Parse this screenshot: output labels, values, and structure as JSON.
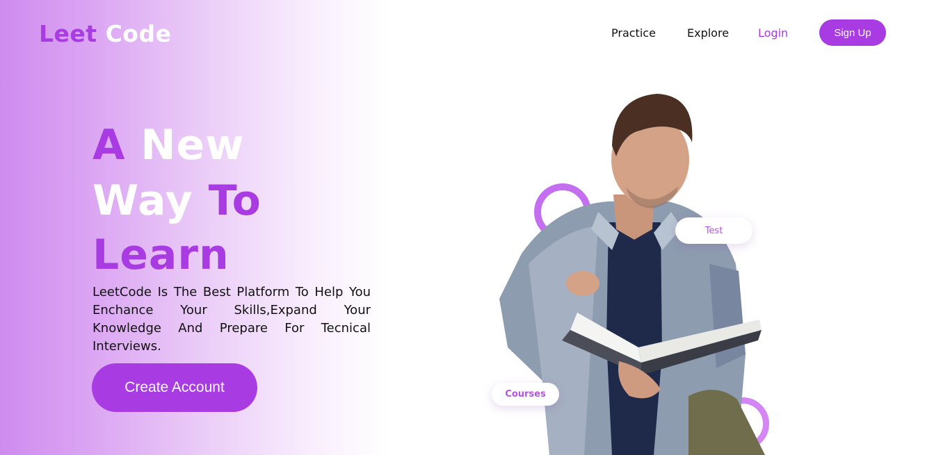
{
  "header": {
    "logo": {
      "part1": "Leet",
      "part2": "Code"
    },
    "nav": [
      {
        "label": "Practice"
      },
      {
        "label": "Explore"
      },
      {
        "label": "Login"
      }
    ],
    "signup_label": "Sign Up"
  },
  "hero": {
    "title_line1": {
      "a": "A",
      "b": "New"
    },
    "title_line2": {
      "a": "Way",
      "b": "To"
    },
    "title_line3": "Learn",
    "description": "LeetCode Is The Best Platform To Help You Enchance Your Skills,Expand Your Knowledge And Prepare For Tecnical Interviews.",
    "cta_label": "Create Account"
  },
  "illustration": {
    "tags": [
      {
        "label": "Test"
      },
      {
        "label": "Courses"
      }
    ],
    "icon": "student-reading-book"
  },
  "colors": {
    "accent": "#a93be3",
    "ring": "#c46ef0",
    "gradient_start": "#cf8cef"
  }
}
